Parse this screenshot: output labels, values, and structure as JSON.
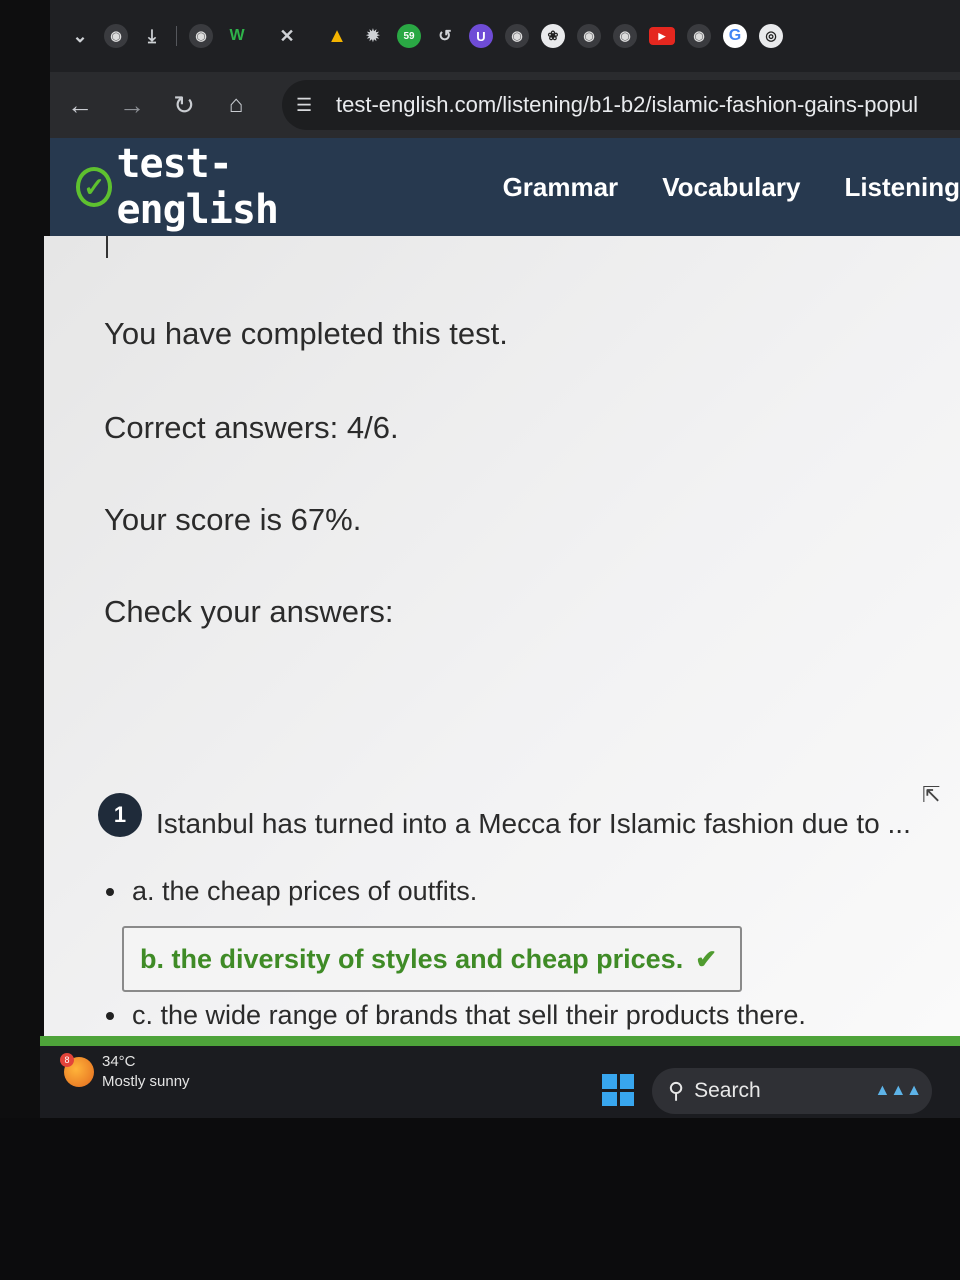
{
  "browser": {
    "tab_icons": [
      "chevron-down-icon",
      "globe-icon",
      "download-icon",
      "globe-icon",
      "w-icon",
      "close-icon",
      "drive-icon",
      "gear-icon",
      "whatsapp-icon",
      "link-icon",
      "extension-icon",
      "globe-icon",
      "chatgpt-icon",
      "globe-icon",
      "globe-icon",
      "youtube-icon",
      "globe-icon",
      "google-icon",
      "chrome-icon"
    ],
    "whatsapp_badge": "59",
    "url": "test-english.com/listening/b1-b2/islamic-fashion-gains-popul"
  },
  "site": {
    "logo_text": "test-english",
    "nav": [
      "Grammar",
      "Vocabulary",
      "Listening"
    ]
  },
  "result": {
    "completed": "You have completed this test.",
    "correct": "Correct answers: 4/6.",
    "score": "Your score is 67%.",
    "check": "Check your answers:"
  },
  "question": {
    "number": "1",
    "text": "Istanbul has turned into a Mecca for Islamic fashion due to ...",
    "options": [
      "a. the cheap prices of outfits.",
      "b. the diversity of styles and cheap prices.",
      "c. the wide range of brands that sell their products there."
    ],
    "correct_index": 1,
    "correct_color": "#3f8b26"
  },
  "taskbar": {
    "weather_temp": "34°C",
    "weather_desc": "Mostly sunny",
    "weather_badge": "8",
    "search_label": "Search"
  }
}
